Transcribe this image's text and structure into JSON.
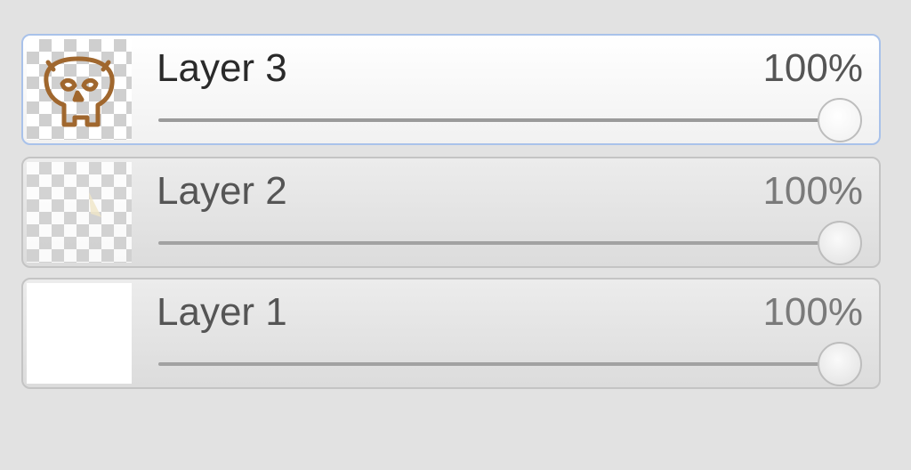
{
  "layers": [
    {
      "name": "Layer 3",
      "opacity_label": "100%",
      "opacity": 1.0,
      "selected": true,
      "thumbnail": "skull-drawing-icon"
    },
    {
      "name": "Layer 2",
      "opacity_label": "100%",
      "opacity": 1.0,
      "selected": false,
      "thumbnail": "faint-stroke-icon"
    },
    {
      "name": "Layer 1",
      "opacity_label": "100%",
      "opacity": 1.0,
      "selected": false,
      "thumbnail": "white-fill"
    }
  ],
  "colors": {
    "background": "#e2e2e2",
    "selected_border": "#a9c2ea",
    "skull_stroke": "#a0672e"
  }
}
